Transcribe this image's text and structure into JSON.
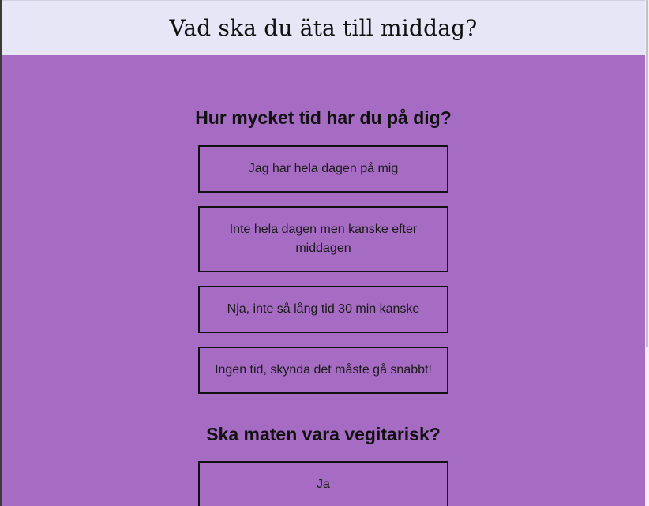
{
  "header": {
    "title": "Vad ska du äta till middag?"
  },
  "questions": [
    {
      "title": "Hur mycket tid har du på dig?",
      "options": [
        {
          "label": "Jag har hela dagen på mig"
        },
        {
          "label": "Inte hela dagen men kanske efter middagen"
        },
        {
          "label": "Nja, inte så lång tid 30 min kanske"
        },
        {
          "label": "Ingen tid, skynda det måste gå snabbt!"
        }
      ]
    },
    {
      "title": "Ska maten vara vegitarisk?",
      "options": [
        {
          "label": "Ja"
        }
      ]
    }
  ],
  "colors": {
    "page_background": "#a66bc2",
    "header_background": "#e6e6f7",
    "border": "#111111"
  }
}
